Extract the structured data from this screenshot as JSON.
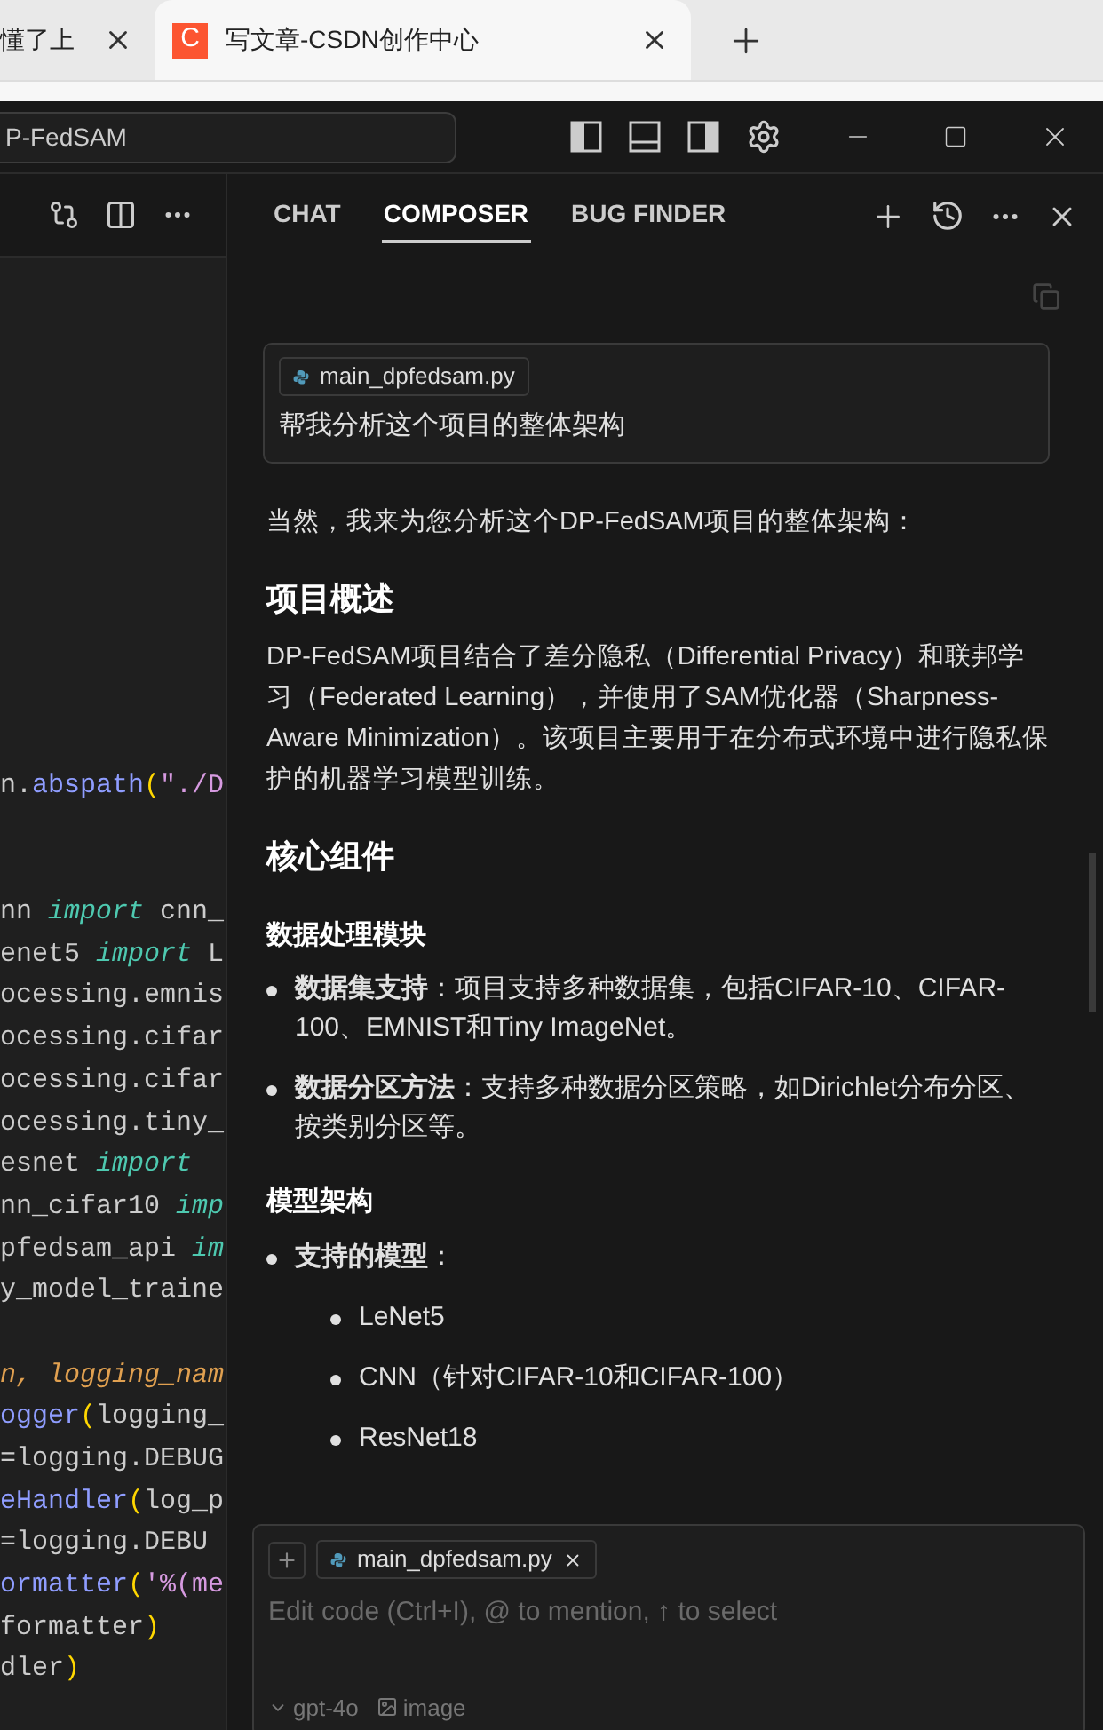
{
  "browser": {
    "tabs": [
      {
        "title": "懂了上",
        "selected": false
      },
      {
        "title": "写文章-CSDN创作中心",
        "selected": true,
        "logo": "C"
      }
    ]
  },
  "titlebar": {
    "search": "P-FedSAM"
  },
  "editor": {
    "lines": [
      [
        {
          "kind": "plain",
          "text": "n."
        },
        {
          "kind": "func",
          "text": "abspath"
        },
        {
          "kind": "paren",
          "text": "("
        },
        {
          "kind": "string",
          "text": "\"./D"
        }
      ],
      [
        {
          "kind": "blank"
        }
      ],
      [
        {
          "kind": "blank"
        }
      ],
      [
        {
          "kind": "plain",
          "text": "nn "
        },
        {
          "kind": "keyword",
          "text": "import"
        },
        {
          "kind": "plain",
          "text": " cnn_"
        }
      ],
      [
        {
          "kind": "plain",
          "text": "enet5 "
        },
        {
          "kind": "keyword",
          "text": "import"
        },
        {
          "kind": "plain",
          "text": " L"
        }
      ],
      [
        {
          "kind": "plain",
          "text": "ocessing.emnis"
        }
      ],
      [
        {
          "kind": "plain",
          "text": "ocessing.cifar"
        }
      ],
      [
        {
          "kind": "plain",
          "text": "ocessing.cifar"
        }
      ],
      [
        {
          "kind": "plain",
          "text": "ocessing.tiny_"
        }
      ],
      [
        {
          "kind": "plain",
          "text": "esnet "
        },
        {
          "kind": "keyword",
          "text": "import"
        }
      ],
      [
        {
          "kind": "plain",
          "text": "nn_cifar10 "
        },
        {
          "kind": "keyword",
          "text": "imp"
        }
      ],
      [
        {
          "kind": "plain",
          "text": "pfedsam_api "
        },
        {
          "kind": "keyword",
          "text": "im"
        }
      ],
      [
        {
          "kind": "plain",
          "text": "y_model_traine"
        }
      ],
      [
        {
          "kind": "blank"
        }
      ],
      [
        {
          "kind": "param",
          "text": "n, logging_nam"
        }
      ],
      [
        {
          "kind": "func",
          "text": "ogger"
        },
        {
          "kind": "paren",
          "text": "("
        },
        {
          "kind": "plain",
          "text": "logging_"
        }
      ],
      [
        {
          "kind": "plain",
          "text": "=logging.DEBUG"
        }
      ],
      [
        {
          "kind": "func",
          "text": "eHandler"
        },
        {
          "kind": "paren",
          "text": "("
        },
        {
          "kind": "plain",
          "text": "log_p"
        }
      ],
      [
        {
          "kind": "plain",
          "text": "=logging.DEBU"
        }
      ],
      [
        {
          "kind": "func",
          "text": "ormatter"
        },
        {
          "kind": "paren",
          "text": "("
        },
        {
          "kind": "string",
          "text": "'%(me"
        }
      ],
      [
        {
          "kind": "plain",
          "text": "formatter"
        },
        {
          "kind": "paren",
          "text": ")"
        }
      ],
      [
        {
          "kind": "plain",
          "text": "dler"
        },
        {
          "kind": "paren",
          "text": ")"
        }
      ]
    ]
  },
  "panel": {
    "tabs": [
      {
        "label": "CHAT",
        "selected": false
      },
      {
        "label": "COMPOSER",
        "selected": true
      },
      {
        "label": "BUG FINDER",
        "selected": false
      }
    ],
    "user_message": {
      "file": "main_dpfedsam.py",
      "text": "帮我分析这个项目的整体架构"
    },
    "response": [
      {
        "kind": "paragraph",
        "text": "当然，我来为您分析这个DP-FedSAM项目的整体架构："
      },
      {
        "kind": "heading",
        "text": "项目概述"
      },
      {
        "kind": "paragraph",
        "text": "DP-FedSAM项目结合了差分隐私（Differential Privacy）和联邦学习（Federated Learning），并使用了SAM优化器（Sharpness-Aware Minimization）。该项目主要用于在分布式环境中进行隐私保护的机器学习模型训练。"
      },
      {
        "kind": "heading",
        "text": "核心组件"
      },
      {
        "kind": "subheading",
        "text": "数据处理模块"
      },
      {
        "kind": "bullets",
        "items": [
          {
            "text": "**数据集支持**：项目支持多种数据集，包括CIFAR-10、CIFAR-100、EMNIST和Tiny ImageNet。"
          },
          {
            "text": "**数据分区方法**：支持多种数据分区策略，如Dirichlet分布分区、按类别分区等。"
          }
        ]
      },
      {
        "kind": "subheading",
        "text": "模型架构"
      },
      {
        "kind": "bullets",
        "items": [
          {
            "text": "**支持的模型**：",
            "children": [
              {
                "text": "LeNet5"
              },
              {
                "text": "CNN（针对CIFAR-10和CIFAR-100）"
              },
              {
                "text": "ResNet18"
              }
            ]
          }
        ]
      }
    ],
    "composer": {
      "file": "main_dpfedsam.py",
      "placeholder": "Edit code (Ctrl+I), @ to mention, ↑ to select",
      "model": "gpt-4o",
      "image_label": "image"
    }
  }
}
